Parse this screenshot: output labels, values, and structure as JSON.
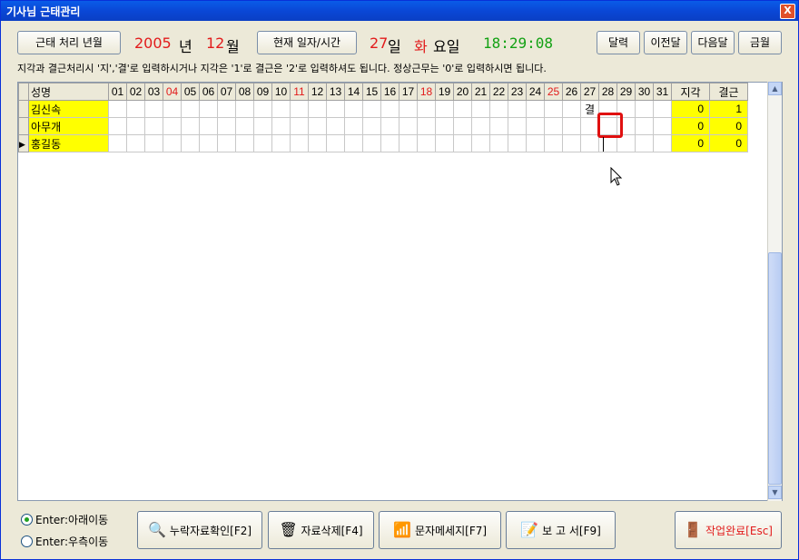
{
  "window": {
    "title": "기사님 근태관리",
    "close": "X"
  },
  "toolbar": {
    "month_btn": "근태 처리 년월",
    "year": "2005",
    "year_suffix": "년",
    "month": "12",
    "month_suffix": "월",
    "today_btn": "현재 일자/시간",
    "day": "27",
    "day_suffix": "일",
    "weekday": "화",
    "weekday_suffix": "요일",
    "time": "18:29:08",
    "calendar_btn": "달력",
    "prev_btn": "이전달",
    "next_btn": "다음달",
    "current_btn": "금월"
  },
  "info": "지각과 결근처리시 '지','결'로 입력하시거나 지각은 '1'로 결근은 '2'로 입력하셔도 됩니다.  정상근무는 '0'로 입력하시면 됩니다.",
  "grid": {
    "name_header": "성명",
    "days": [
      "01",
      "02",
      "03",
      "04",
      "05",
      "06",
      "07",
      "08",
      "09",
      "10",
      "11",
      "12",
      "13",
      "14",
      "15",
      "16",
      "17",
      "18",
      "19",
      "20",
      "21",
      "22",
      "23",
      "24",
      "25",
      "26",
      "27",
      "28",
      "29",
      "30",
      "31"
    ],
    "red_days": [
      "04",
      "11",
      "18",
      "25"
    ],
    "late_header": "지각",
    "absent_header": "결근",
    "rows": [
      {
        "name": "김신속",
        "cells": {
          "27": "결"
        },
        "late": "0",
        "absent": "1"
      },
      {
        "name": "아무개",
        "cells": {},
        "late": "0",
        "absent": "0"
      },
      {
        "name": "홍길동",
        "cells": {},
        "late": "0",
        "absent": "0"
      }
    ]
  },
  "options": {
    "enter_down": "Enter:아래이동",
    "enter_right": "Enter:우측이동"
  },
  "buttons": {
    "missing": "누락자료확인[F2]",
    "delete": "자료삭제[F4]",
    "sms": "문자메세지[F7]",
    "report": "보 고 서[F9]",
    "done": "작업완료[Esc]"
  },
  "colors": {
    "accent_red": "#e21b1b",
    "time_green": "#13a113",
    "name_bg": "#ffff00"
  }
}
